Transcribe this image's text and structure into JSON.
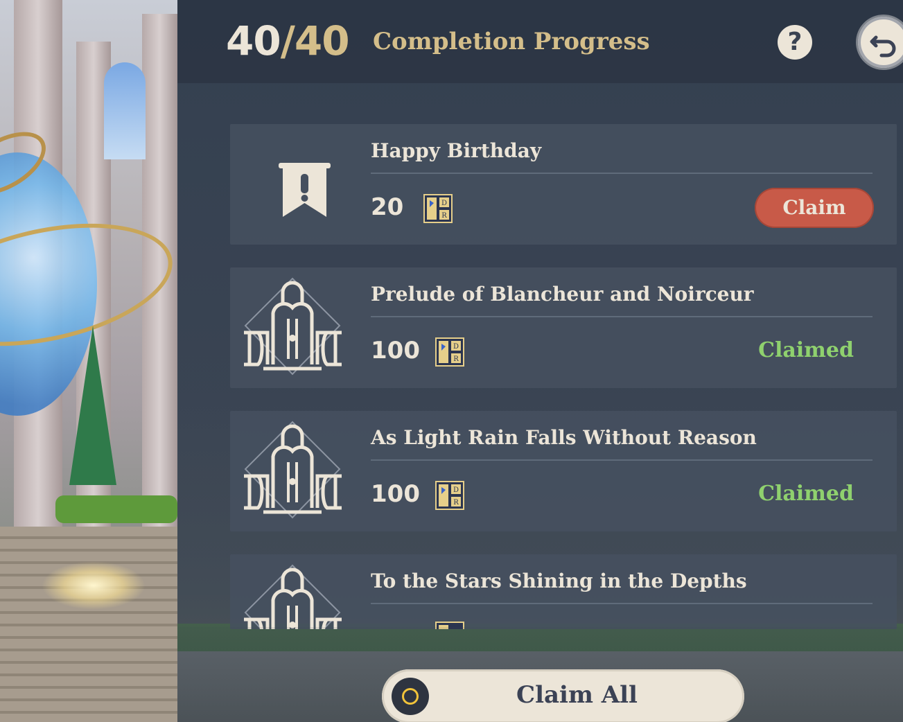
{
  "header": {
    "progress_current": "40",
    "progress_separator": "/",
    "progress_total": "40",
    "title": "Completion Progress",
    "help_label": "?",
    "back_icon": "back-arrow-icon"
  },
  "items": [
    {
      "title": "Happy Birthday",
      "reward_amount": "20",
      "reward_icon": "event-ticket-icon",
      "emblem_icon": "exclamation-banner-icon",
      "status": "claimable",
      "action_label": "Claim"
    },
    {
      "title": "Prelude of Blancheur and Noirceur",
      "reward_amount": "100",
      "reward_icon": "event-ticket-icon",
      "emblem_icon": "fontaine-emblem-icon",
      "status": "claimed",
      "status_label": "Claimed"
    },
    {
      "title": "As Light Rain Falls Without Reason",
      "reward_amount": "100",
      "reward_icon": "event-ticket-icon",
      "emblem_icon": "fontaine-emblem-icon",
      "status": "claimed",
      "status_label": "Claimed"
    },
    {
      "title": "To the Stars Shining in the Depths",
      "reward_icon": "event-ticket-icon",
      "emblem_icon": "fontaine-emblem-icon"
    }
  ],
  "footer": {
    "claim_all_label": "Claim All",
    "claim_all_icon": "controller-button-icon"
  },
  "colors": {
    "accent_gold": "#d4be8a",
    "text_light": "#ece5d8",
    "claim_red": "#c85a48",
    "claimed_green": "#8fd16e",
    "card_bg": "#46505f"
  }
}
